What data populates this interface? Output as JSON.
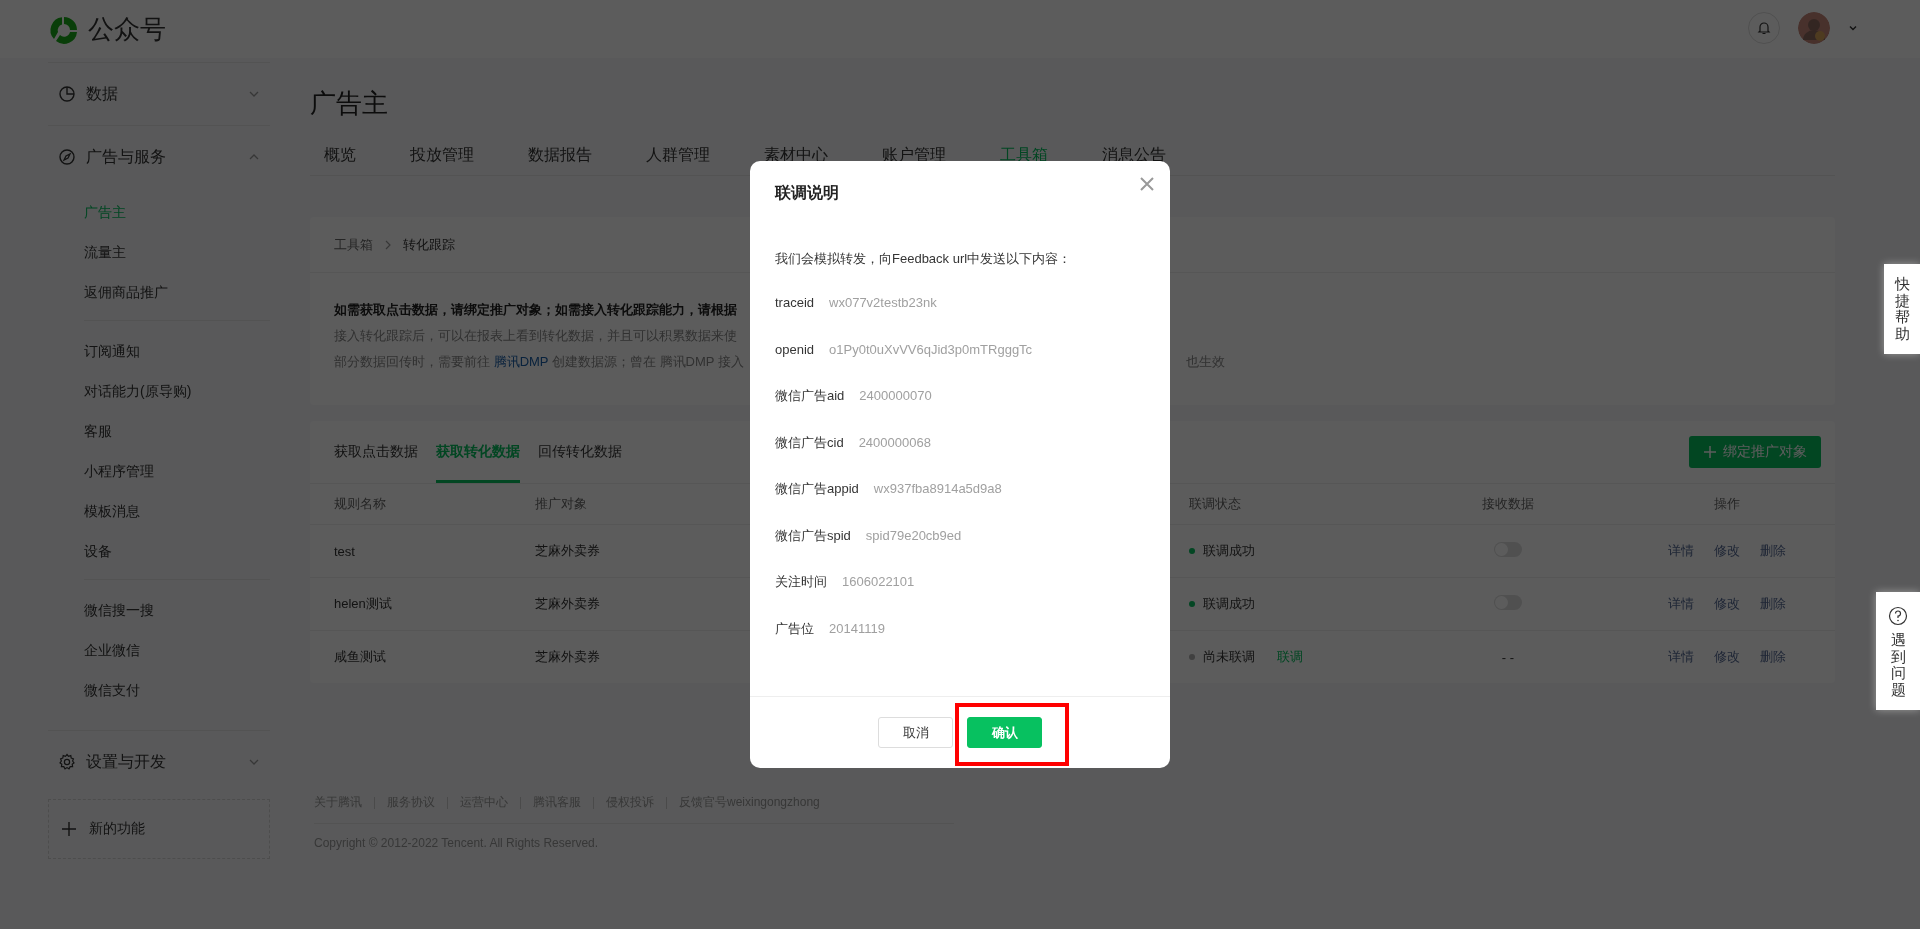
{
  "header": {
    "logo_text": "公众号"
  },
  "sidebar": {
    "sections": [
      {
        "label": "数据",
        "expanded": false
      },
      {
        "label": "广告与服务",
        "expanded": true,
        "groups": [
          {
            "items": [
              {
                "label": "广告主",
                "selected": true
              },
              {
                "label": "流量主",
                "selected": false
              },
              {
                "label": "返佣商品推广",
                "selected": false
              }
            ]
          },
          {
            "items": [
              {
                "label": "订阅通知",
                "selected": false
              },
              {
                "label": "对话能力(原导购)",
                "selected": false
              },
              {
                "label": "客服",
                "selected": false
              },
              {
                "label": "小程序管理",
                "selected": false
              },
              {
                "label": "模板消息",
                "selected": false
              },
              {
                "label": "设备",
                "selected": false
              }
            ]
          },
          {
            "items": [
              {
                "label": "微信搜一搜",
                "selected": false
              },
              {
                "label": "企业微信",
                "selected": false
              },
              {
                "label": "微信支付",
                "selected": false
              }
            ]
          }
        ]
      },
      {
        "label": "设置与开发",
        "expanded": false
      }
    ],
    "new_feature": "新的功能"
  },
  "page_title": "广告主",
  "tabs": [
    {
      "label": "概览",
      "selected": false
    },
    {
      "label": "投放管理",
      "selected": false
    },
    {
      "label": "数据报告",
      "selected": false
    },
    {
      "label": "人群管理",
      "selected": false
    },
    {
      "label": "素材中心",
      "selected": false
    },
    {
      "label": "账户管理",
      "selected": false
    },
    {
      "label": "工具箱",
      "selected": true
    },
    {
      "label": "消息公告",
      "selected": false
    }
  ],
  "info_card": {
    "breadcrumb": [
      "工具箱",
      "转化跟踪"
    ],
    "headline": "如需获取点击数据，请绑定推广对象；如需接入转化跟踪能力，请根据",
    "lines": [
      {
        "segments": [
          {
            "text": "接入转化跟踪后，可以在报表上看到转化数据，并且可以积累数据来使"
          }
        ]
      },
      {
        "segments": [
          {
            "text": "部分数据回传时，需要前往 "
          },
          {
            "text": "腾讯DMP",
            "link": true
          },
          {
            "text": " 创建数据源；曾在 腾讯DMP 接入"
          }
        ],
        "tail": "也生效"
      }
    ]
  },
  "table_card": {
    "tabs": [
      {
        "label": "获取点击数据",
        "selected": false
      },
      {
        "label": "获取转化数据",
        "selected": true
      },
      {
        "label": "回传转化数据",
        "selected": false
      }
    ],
    "bind_button": "绑定推广对象",
    "columns": [
      "规则名称",
      "推广对象",
      "联调状态",
      "接收数据",
      "操作"
    ],
    "rows": [
      {
        "name": "test",
        "target": "芝麻外卖券",
        "status": {
          "text": "联调成功",
          "color": "#034623"
        },
        "receive": {
          "kind": "toggle",
          "on": false
        },
        "actions": [
          "详情",
          "修改",
          "删除"
        ]
      },
      {
        "name": "helen测试",
        "target": "芝麻外卖券",
        "status": {
          "text": "联调成功",
          "color": "#034623"
        },
        "receive": {
          "kind": "toggle",
          "on": false
        },
        "actions": [
          "详情",
          "修改",
          "删除"
        ]
      },
      {
        "name": "咸鱼测试",
        "target": "芝麻外卖券",
        "status": {
          "text": "尚未联调",
          "color": "#404040",
          "link": "联调"
        },
        "receive": {
          "kind": "text",
          "text": "- -"
        },
        "actions": [
          "详情",
          "修改",
          "删除"
        ]
      }
    ]
  },
  "footer": {
    "links": [
      "关于腾讯",
      "服务协议",
      "运营中心",
      "腾讯客服",
      "侵权投诉",
      "反馈官号weixingongzhong"
    ],
    "copyright": "Copyright © 2012-2022 Tencent. All Rights Reserved."
  },
  "side_tabs": [
    {
      "kind": "quick",
      "label": "快捷帮助"
    },
    {
      "kind": "question",
      "label": "遇到问题"
    }
  ],
  "modal": {
    "title": "联调说明",
    "intro": "我们会模拟转发，向Feedback url中发送以下内容：",
    "fields": [
      {
        "key": "traceid",
        "value": "wx077v2testb23nk"
      },
      {
        "key": "openid",
        "value": "o1Py0t0uXvVV6qJid3p0mTRgggTc"
      },
      {
        "key": "微信广告aid",
        "value": "2400000070"
      },
      {
        "key": "微信广告cid",
        "value": "2400000068"
      },
      {
        "key": "微信广告appid",
        "value": "wx937fba8914a5d9a8"
      },
      {
        "key": "微信广告spid",
        "value": "spid79e20cb9ed"
      },
      {
        "key": "关注时间",
        "value": "1606022101"
      },
      {
        "key": "广告位",
        "value": "20141119"
      }
    ],
    "buttons": [
      {
        "label": "取消",
        "kind": "default",
        "highlighted": false
      },
      {
        "label": "确认",
        "kind": "primary",
        "highlighted": true
      }
    ]
  }
}
